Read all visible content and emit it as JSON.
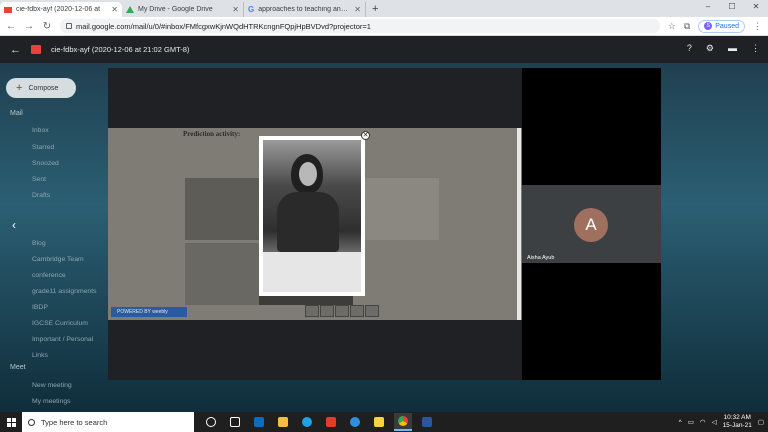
{
  "browser": {
    "tabs": [
      {
        "label": "cie-fdbx-ayf (2020-12-06 at",
        "favicon_color": "#ea4335"
      },
      {
        "label": "My Drive - Google Drive",
        "favicon_color": "#34a853"
      },
      {
        "label": "approaches to teaching and lea",
        "favicon_color": "#4285f4"
      }
    ],
    "new_tab": "+",
    "window_controls": [
      "–",
      "☐",
      "✕"
    ],
    "url": "mail.google.com/mail/u/0/#inbox/FMfcgxwKjnWQdHTRKcngnFQpjHpBVDvd?projector=1",
    "profile_status": "Paused",
    "profile_initial": "S"
  },
  "gmail": {
    "compose_label": "Compose",
    "sections": {
      "mail": "Mail",
      "meet": "Meet"
    },
    "items": [
      "Inbox",
      "Starred",
      "Snoozed",
      "Sent",
      "Drafts",
      "Blog",
      "Cambridge Team",
      "conference",
      "grade11 assignments",
      "IBDP",
      "IGCSE Curriculum",
      "Important / Personal",
      "Links"
    ],
    "meet_items": [
      "New meeting",
      "My meetings"
    ]
  },
  "presentation": {
    "title": "cie-fdbx-ayf (2020-12-06 at 21:02 GMT-8)",
    "slide_heading": "Prediction activity:",
    "weebly_badge": "POWERED BY  weebly",
    "lightbox_close": "✕"
  },
  "participant": {
    "initial": "A",
    "name": "Aisha Ayub",
    "avatar_color": "#a0705e"
  },
  "taskbar": {
    "search_placeholder": "Type here to search",
    "time": "10:32 AM",
    "date": "15-Jan-21"
  }
}
